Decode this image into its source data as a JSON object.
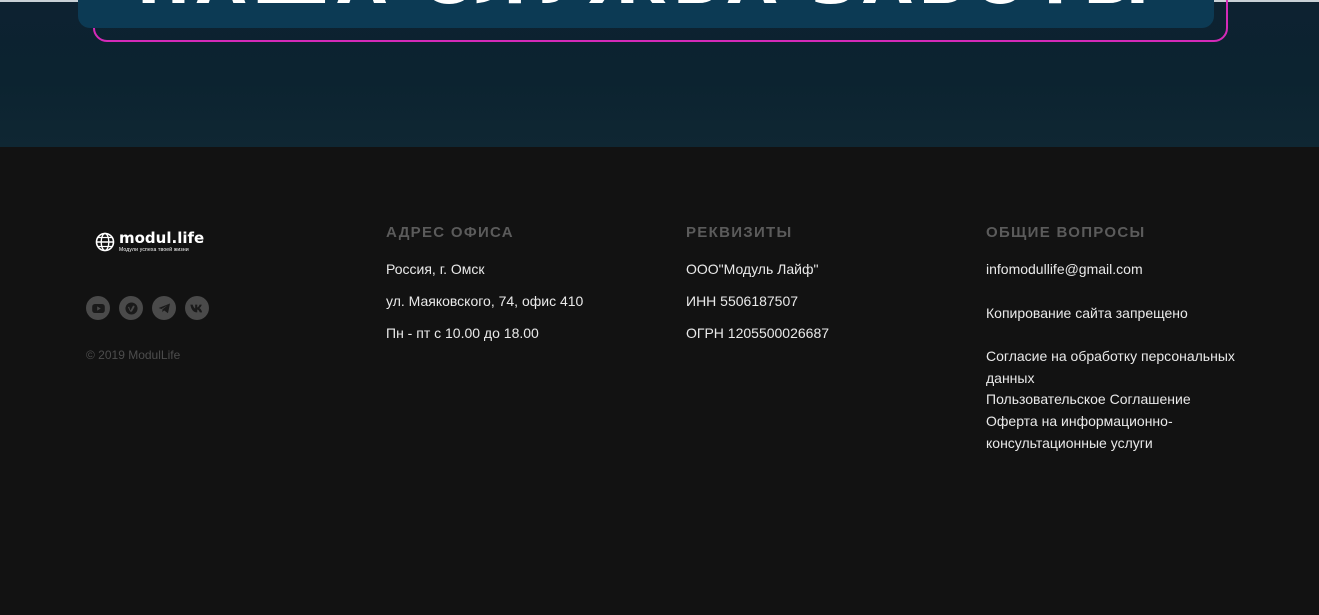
{
  "hero": {
    "title": "НАША СЛУЖБА ЗАБОТЫ"
  },
  "brand": {
    "logo_name": "modul.life",
    "logo_tagline": "Модули успеха твоей жизни",
    "logo_icon": "globe-icon",
    "copyright": "© 2019 ModulLife",
    "socials": [
      {
        "name": "youtube",
        "icon": "youtube-icon"
      },
      {
        "name": "vimeo",
        "icon": "vimeo-icon"
      },
      {
        "name": "telegram",
        "icon": "telegram-icon"
      },
      {
        "name": "vk",
        "icon": "vk-icon"
      }
    ]
  },
  "address": {
    "heading": "АДРЕС ОФИСА",
    "lines": [
      "Россия, г. Омск",
      "ул. Маяковского, 74, офис 410",
      "Пн - пт с 10.00 до 18.00"
    ]
  },
  "requisites": {
    "heading": "РЕКВИЗИТЫ",
    "lines": [
      "ООО\"Модуль Лайф\"",
      "ИНН 5506187507",
      "ОГРН 1205500026687"
    ]
  },
  "general": {
    "heading": "ОБЩИЕ ВОПРОСЫ",
    "email": "infomodullife@gmail.com",
    "copy_notice": "Копирование сайта запрещено",
    "links": [
      "Согласие на обработку персональных",
      "данных",
      "Пользовательское Соглашение",
      "Оферта на информационно-",
      "консультационные услуги"
    ]
  },
  "colors": {
    "hero_bg": "#0d2231",
    "hero_panel": "#0c3a54",
    "hero_frame": "#d42ab8",
    "footer_bg": "#121212",
    "heading": "#5b5b5b",
    "text": "#e9e9e9",
    "social_bg": "#4a4a4a"
  }
}
